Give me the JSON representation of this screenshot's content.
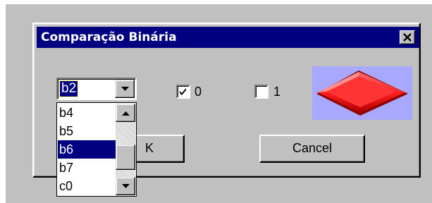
{
  "dialog": {
    "title": "Comparação Binária",
    "close_label": "close"
  },
  "combo": {
    "value": "b2"
  },
  "dropdown": {
    "items": [
      {
        "label": "b4",
        "selected": false
      },
      {
        "label": "b5",
        "selected": false
      },
      {
        "label": "b6",
        "selected": true
      },
      {
        "label": "b7",
        "selected": false
      },
      {
        "label": "c0",
        "selected": false
      }
    ]
  },
  "checkboxes": [
    {
      "label": "0",
      "checked": true
    },
    {
      "label": "1",
      "checked": false
    }
  ],
  "buttons": {
    "ok_label": "K",
    "cancel_label": "Cancel"
  },
  "colors": {
    "titlebar": "#000080",
    "face": "#c0c0c0",
    "selection": "#000080",
    "preview_bg": "#a8a8ff",
    "diamond": "#ff3030"
  },
  "icons": {
    "close": "close-icon",
    "dropdown_arrow": "chevron-down-icon",
    "scroll_up": "chevron-up-icon",
    "scroll_down": "chevron-down-icon",
    "check": "check-icon",
    "preview": "red-diamond-shape"
  }
}
